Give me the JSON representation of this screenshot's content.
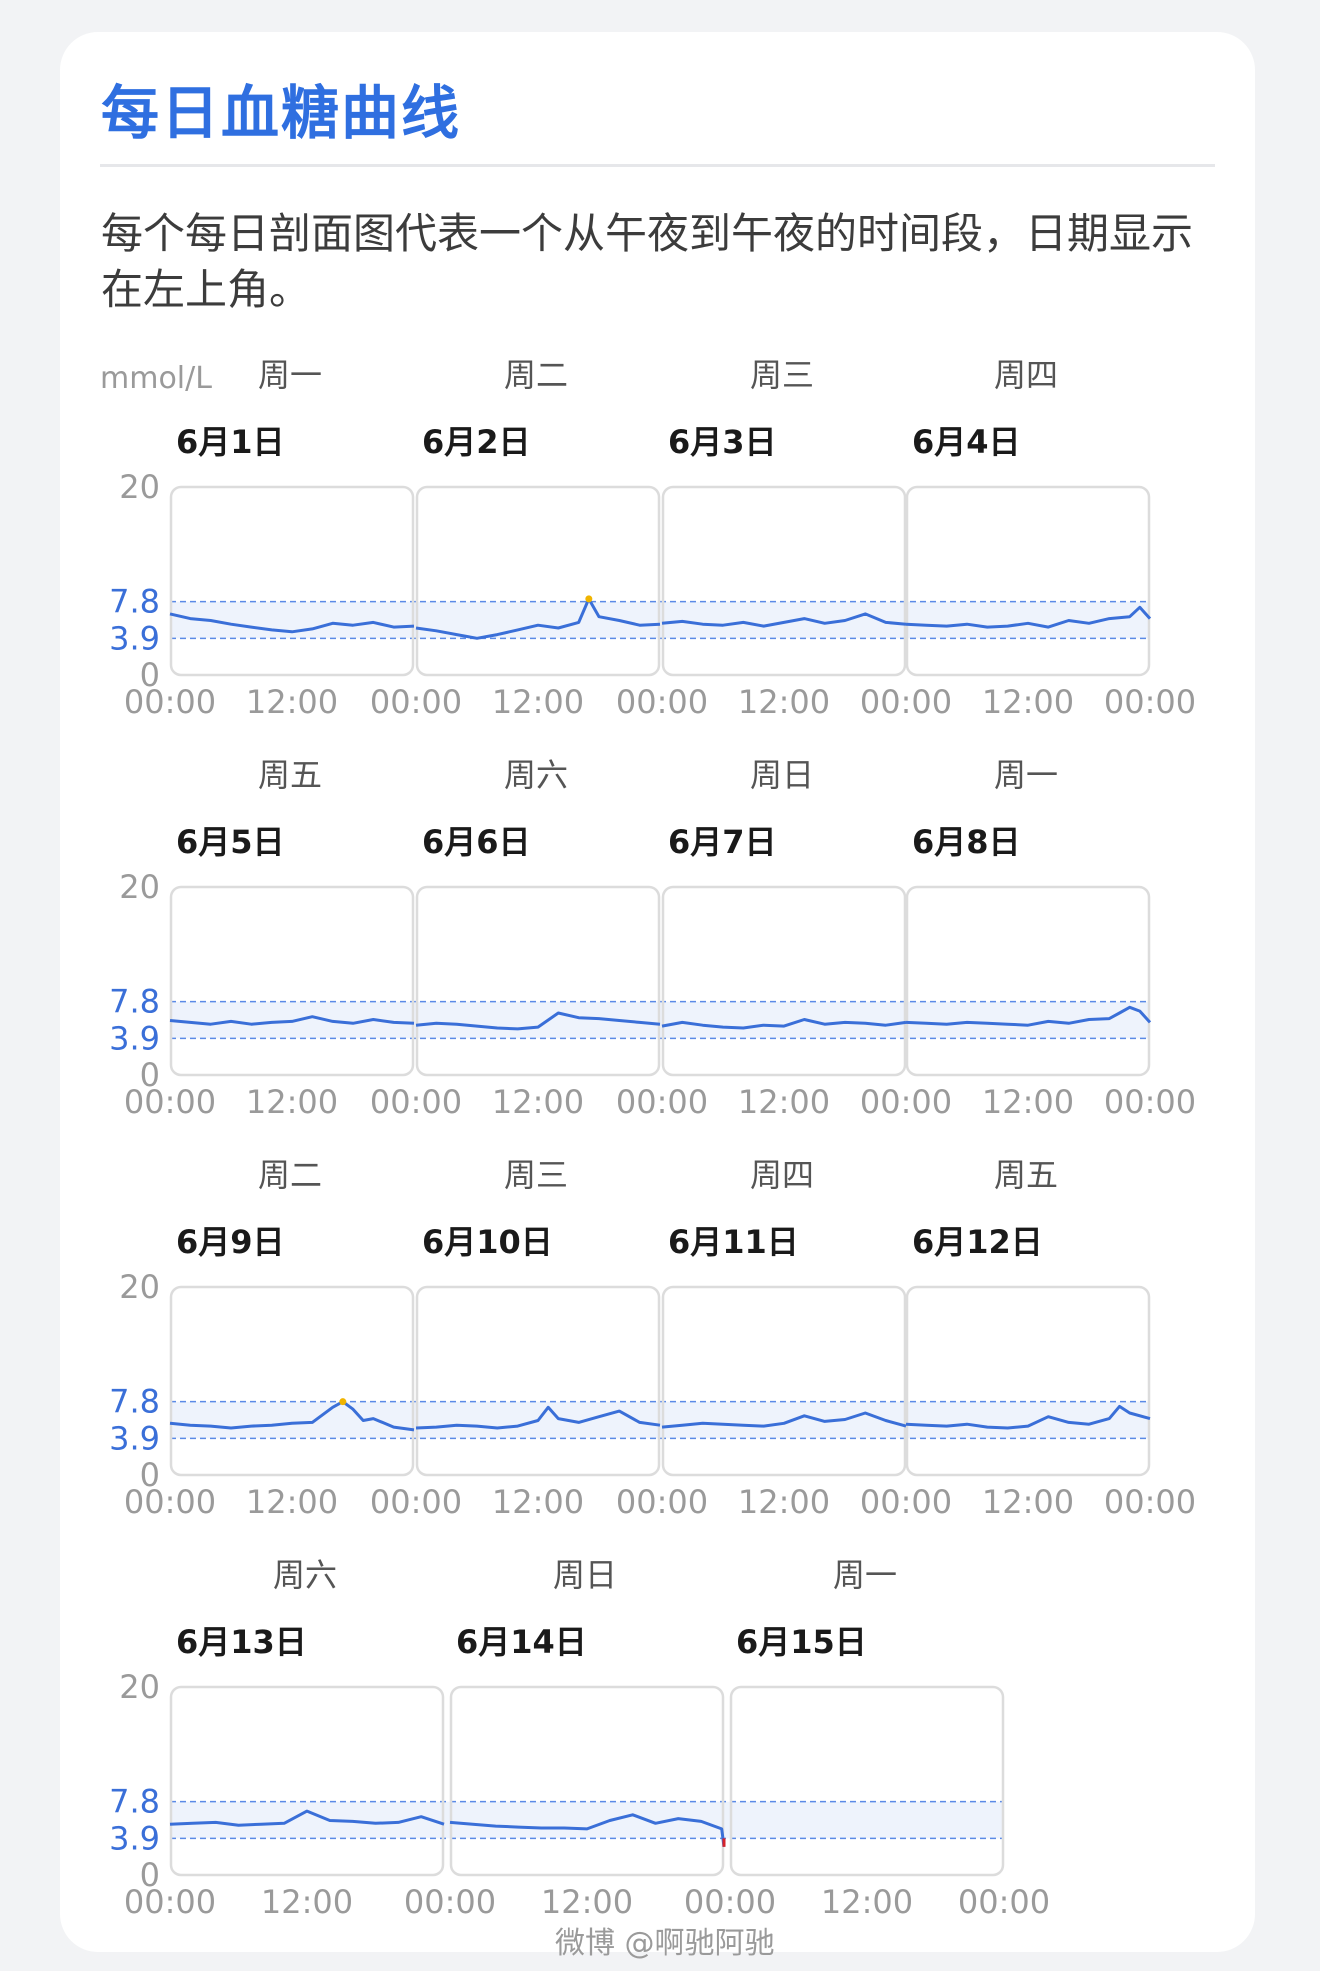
{
  "header": {
    "title": "每日血糖曲线",
    "description": "每个每日剖面图代表一个从午夜到午夜的时间段，日期显示在左上角。"
  },
  "watermark": "微博 @啊驰阿驰",
  "colors": {
    "accent": "#2f6fe0",
    "line": "#3a6fd8",
    "band": "#eef3fc",
    "high": "#f0b400",
    "low": "#d6232a"
  },
  "chart_data": {
    "type": "line",
    "unit": "mmol/L",
    "ylim": [
      0,
      20
    ],
    "y_ticks": [
      "20",
      "7.8",
      "3.9",
      "0"
    ],
    "target_range": [
      3.9,
      7.8
    ],
    "x_ticks": [
      "00:00",
      "12:00"
    ],
    "rows": [
      {
        "days": [
          {
            "weekday": "周一",
            "date": "6月1日",
            "x": [
              0,
              2,
              4,
              6,
              8,
              10,
              12,
              14,
              16,
              18,
              20,
              22,
              24
            ],
            "y": [
              6.5,
              6.0,
              5.8,
              5.4,
              5.1,
              4.8,
              4.6,
              4.9,
              5.5,
              5.3,
              5.6,
              5.1,
              5.2
            ]
          },
          {
            "weekday": "周二",
            "date": "6月2日",
            "x": [
              0,
              2,
              4,
              6,
              8,
              10,
              12,
              14,
              16,
              17,
              18,
              20,
              22,
              24
            ],
            "y": [
              5.0,
              4.7,
              4.3,
              3.9,
              4.3,
              4.8,
              5.3,
              5.0,
              5.6,
              8.1,
              6.2,
              5.8,
              5.3,
              5.4
            ]
          },
          {
            "weekday": "周三",
            "date": "6月3日",
            "x": [
              0,
              2,
              4,
              6,
              8,
              10,
              12,
              14,
              16,
              18,
              20,
              22,
              24
            ],
            "y": [
              5.5,
              5.7,
              5.4,
              5.3,
              5.6,
              5.2,
              5.6,
              6.0,
              5.5,
              5.8,
              6.5,
              5.6,
              5.4
            ]
          },
          {
            "weekday": "周四",
            "date": "6月4日",
            "x": [
              0,
              2,
              4,
              6,
              8,
              10,
              12,
              14,
              16,
              18,
              20,
              22,
              23,
              24
            ],
            "y": [
              5.4,
              5.3,
              5.2,
              5.4,
              5.1,
              5.2,
              5.5,
              5.1,
              5.8,
              5.5,
              6.0,
              6.2,
              7.2,
              6.0
            ]
          }
        ]
      },
      {
        "days": [
          {
            "weekday": "周五",
            "date": "6月5日",
            "x": [
              0,
              2,
              4,
              6,
              8,
              10,
              12,
              14,
              16,
              18,
              20,
              22,
              24
            ],
            "y": [
              5.8,
              5.6,
              5.4,
              5.7,
              5.4,
              5.6,
              5.7,
              6.2,
              5.7,
              5.5,
              5.9,
              5.6,
              5.5
            ]
          },
          {
            "weekday": "周六",
            "date": "6月6日",
            "x": [
              0,
              2,
              4,
              6,
              8,
              10,
              12,
              14,
              16,
              18,
              20,
              22,
              24
            ],
            "y": [
              5.3,
              5.5,
              5.4,
              5.2,
              5.0,
              4.9,
              5.1,
              6.6,
              6.1,
              6.0,
              5.8,
              5.6,
              5.4
            ]
          },
          {
            "weekday": "周日",
            "date": "6月7日",
            "x": [
              0,
              2,
              4,
              6,
              8,
              10,
              12,
              14,
              16,
              18,
              20,
              22,
              24
            ],
            "y": [
              5.2,
              5.6,
              5.3,
              5.1,
              5.0,
              5.3,
              5.2,
              5.9,
              5.4,
              5.6,
              5.5,
              5.3,
              5.6
            ]
          },
          {
            "weekday": "周一",
            "date": "6月8日",
            "x": [
              0,
              2,
              4,
              6,
              8,
              10,
              12,
              14,
              16,
              18,
              20,
              21,
              22,
              23,
              24
            ],
            "y": [
              5.6,
              5.5,
              5.4,
              5.6,
              5.5,
              5.4,
              5.3,
              5.7,
              5.5,
              5.9,
              6.0,
              6.6,
              7.2,
              6.8,
              5.6
            ]
          }
        ]
      },
      {
        "days": [
          {
            "weekday": "周二",
            "date": "6月9日",
            "x": [
              0,
              2,
              4,
              6,
              8,
              10,
              12,
              14,
              16,
              17,
              18,
              19,
              20,
              22,
              24
            ],
            "y": [
              5.5,
              5.3,
              5.2,
              5.0,
              5.2,
              5.3,
              5.5,
              5.6,
              7.2,
              7.8,
              7.0,
              5.8,
              6.0,
              5.1,
              4.8
            ]
          },
          {
            "weekday": "周三",
            "date": "6月10日",
            "x": [
              0,
              2,
              4,
              6,
              8,
              10,
              12,
              13,
              14,
              16,
              18,
              20,
              22,
              24
            ],
            "y": [
              5.0,
              5.1,
              5.3,
              5.2,
              5.0,
              5.2,
              5.8,
              7.2,
              6.0,
              5.6,
              6.2,
              6.8,
              5.6,
              5.3
            ]
          },
          {
            "weekday": "周四",
            "date": "6月11日",
            "x": [
              0,
              2,
              4,
              6,
              8,
              10,
              12,
              14,
              16,
              18,
              20,
              22,
              24
            ],
            "y": [
              5.1,
              5.3,
              5.5,
              5.4,
              5.3,
              5.2,
              5.5,
              6.3,
              5.7,
              5.9,
              6.6,
              5.8,
              5.2
            ]
          },
          {
            "weekday": "周五",
            "date": "6月12日",
            "x": [
              0,
              2,
              4,
              6,
              8,
              10,
              12,
              14,
              16,
              18,
              20,
              21,
              22,
              24
            ],
            "y": [
              5.4,
              5.3,
              5.2,
              5.4,
              5.1,
              5.0,
              5.2,
              6.2,
              5.6,
              5.4,
              6.0,
              7.3,
              6.6,
              6.0
            ]
          }
        ]
      },
      {
        "days": [
          {
            "weekday": "周六",
            "date": "6月13日",
            "x": [
              0,
              2,
              4,
              6,
              8,
              10,
              12,
              14,
              16,
              18,
              20,
              22,
              24
            ],
            "y": [
              5.4,
              5.5,
              5.6,
              5.3,
              5.4,
              5.5,
              6.8,
              5.8,
              5.7,
              5.5,
              5.6,
              6.2,
              5.4
            ]
          },
          {
            "weekday": "周日",
            "date": "6月14日",
            "x": [
              0,
              2,
              4,
              6,
              8,
              10,
              12,
              14,
              16,
              18,
              20,
              22,
              23.8,
              24
            ],
            "y": [
              5.6,
              5.4,
              5.2,
              5.1,
              5.0,
              5.0,
              4.9,
              5.8,
              6.4,
              5.5,
              6.0,
              5.7,
              4.9,
              3.0
            ]
          },
          {
            "weekday": "周一",
            "date": "6月15日",
            "x": [],
            "y": []
          }
        ]
      }
    ]
  }
}
